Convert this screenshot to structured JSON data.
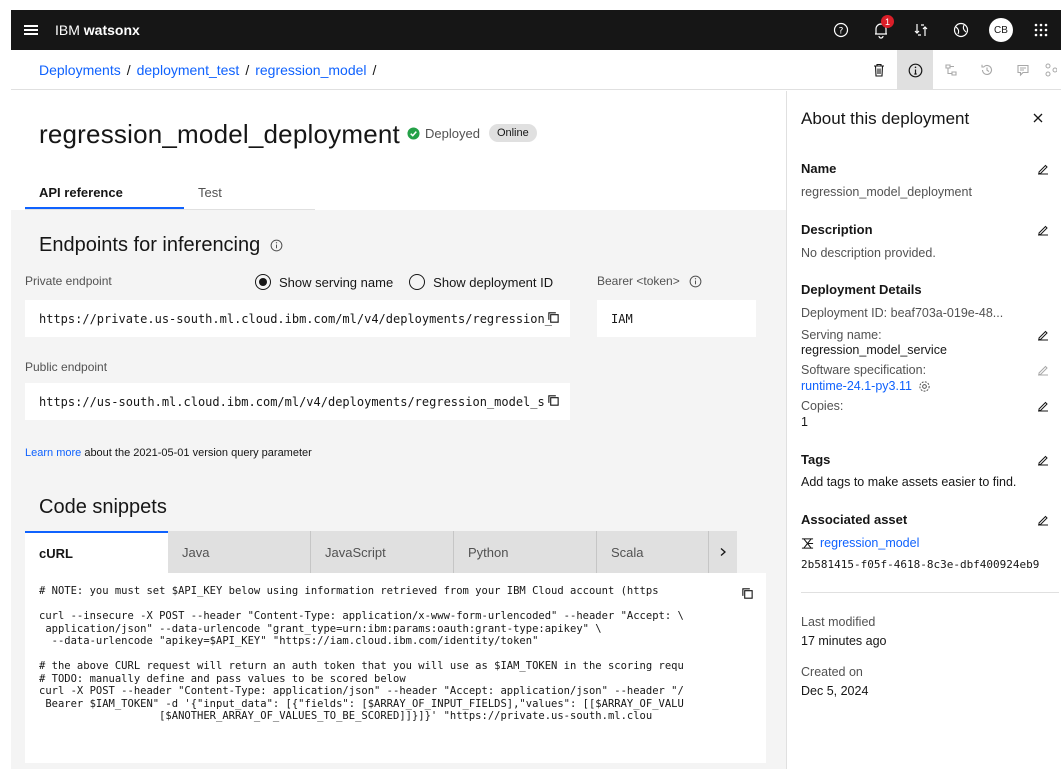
{
  "topbar": {
    "brand_prefix": "IBM",
    "brand_product": "watsonx",
    "notification_count": "1",
    "user_initials": "CB"
  },
  "breadcrumb": {
    "items": [
      "Deployments",
      "deployment_test",
      "regression_model"
    ],
    "separator": "/"
  },
  "page": {
    "title": "regression_model_deployment",
    "status": "Deployed",
    "state_tag": "Online",
    "tabs": [
      {
        "label": "API reference",
        "active": true
      },
      {
        "label": "Test",
        "active": false
      }
    ]
  },
  "endpoints": {
    "heading": "Endpoints for inferencing",
    "private_label": "Private endpoint",
    "private_url": "https://private.us-south.ml.cloud.ibm.com/ml/v4/deployments/regression_",
    "radio_serving": "Show serving name",
    "radio_deployment": "Show deployment ID",
    "bearer_label": "Bearer <token>",
    "bearer_value": "IAM",
    "public_label": "Public endpoint",
    "public_url": "https://us-south.ml.cloud.ibm.com/ml/v4/deployments/regression_model_s",
    "learn_more_link": "Learn more",
    "learn_more_text": " about the 2021-05-01 version query parameter"
  },
  "code": {
    "heading": "Code snippets",
    "tabs": [
      {
        "label": "cURL",
        "active": true
      },
      {
        "label": "Java"
      },
      {
        "label": "JavaScript"
      },
      {
        "label": "Python"
      },
      {
        "label": "Scala"
      }
    ],
    "snippet": "# NOTE: you must set $API_KEY below using information retrieved from your IBM Cloud account (https\n\ncurl --insecure -X POST --header \"Content-Type: application/x-www-form-urlencoded\" --header \"Accept: \\\n application/json\" --data-urlencode \"grant_type=urn:ibm:params:oauth:grant-type:apikey\" \\\n  --data-urlencode \"apikey=$API_KEY\" \"https://iam.cloud.ibm.com/identity/token\"\n\n# the above CURL request will return an auth token that you will use as $IAM_TOKEN in the scoring requ\n# TODO: manually define and pass values to be scored below\ncurl -X POST --header \"Content-Type: application/json\" --header \"Accept: application/json\" --header \"/\n Bearer $IAM_TOKEN\" -d '{\"input_data\": [{\"fields\": [$ARRAY_OF_INPUT_FIELDS],\"values\": [[$ARRAY_OF_VALU\n                   [$ANOTHER_ARRAY_OF_VALUES_TO_BE_SCORED]]}]}' \"https://private.us-south.ml.clou"
  },
  "panel": {
    "title": "About this deployment",
    "name_label": "Name",
    "name_value": "regression_model_deployment",
    "description_label": "Description",
    "description_value": "No description provided.",
    "details_label": "Deployment Details",
    "deployment_id": "Deployment ID: beaf703a-019e-48...",
    "serving_name_label": "Serving name:",
    "serving_name_value": "regression_model_service",
    "software_spec_label": "Software specification:",
    "software_spec_value": "runtime-24.1-py3.11",
    "copies_label": "Copies:",
    "copies_value": "1",
    "tags_label": "Tags",
    "tags_value": "Add tags to make assets easier to find.",
    "asset_label": "Associated asset",
    "asset_name": "regression_model",
    "asset_id": "2b581415-f05f-4618-8c3e-dbf400924eb9",
    "last_modified_label": "Last modified",
    "last_modified_value": "17 minutes ago",
    "created_label": "Created on",
    "created_value": "Dec 5, 2024"
  }
}
